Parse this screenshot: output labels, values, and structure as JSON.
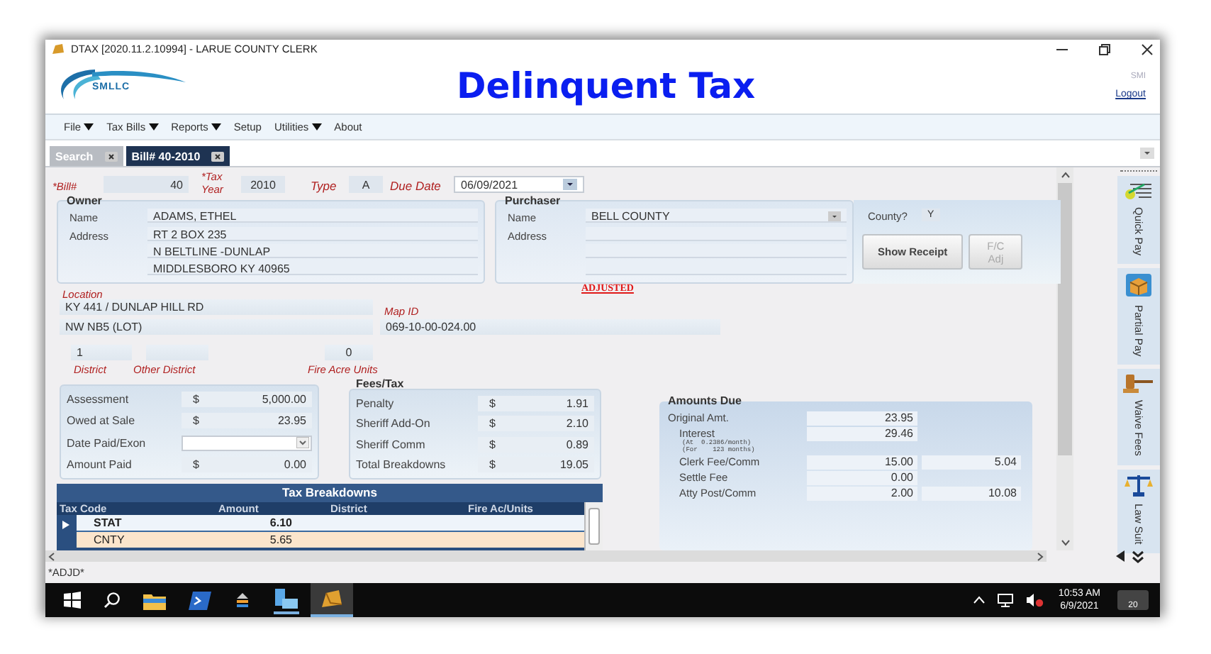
{
  "window": {
    "title": "DTAX [2020.11.2.10994] - LARUE COUNTY CLERK"
  },
  "header": {
    "logo_text": "SMLLC",
    "title": "Delinquent Tax",
    "user": "SMI",
    "logout": "Logout"
  },
  "menu": [
    {
      "label": "File",
      "has_submenu": true
    },
    {
      "label": "Tax Bills",
      "has_submenu": true
    },
    {
      "label": "Reports",
      "has_submenu": true
    },
    {
      "label": "Setup",
      "has_submenu": false
    },
    {
      "label": "Utilities",
      "has_submenu": true
    },
    {
      "label": "About",
      "has_submenu": false
    }
  ],
  "tabs": [
    {
      "label": "Search",
      "selected": false
    },
    {
      "label": "Bill# 40-2010",
      "selected": true
    }
  ],
  "bill": {
    "bill_label": "*Bill#",
    "bill_no": "40",
    "tax_year_label": "*Tax Year",
    "tax_year": "2010",
    "type_label": "Type",
    "type": "A",
    "due_date_label": "Due Date",
    "due_date": "06/09/2021"
  },
  "owner": {
    "legend": "Owner",
    "name_label": "Name",
    "address_label": "Address",
    "name": "ADAMS, ETHEL",
    "address_lines": [
      "RT 2 BOX 235",
      "N BELTLINE -DUNLAP",
      "MIDDLESBORO KY 40965"
    ]
  },
  "purchaser": {
    "legend": "Purchaser",
    "name_label": "Name",
    "address_label": "Address",
    "name": "BELL COUNTY"
  },
  "county": {
    "label": "County?",
    "value": "Y"
  },
  "buttons": [
    {
      "label": "Show Receipt",
      "disabled": false
    },
    {
      "label": "F/C Adj",
      "disabled": true
    }
  ],
  "status_stamp": "ADJUSTED",
  "location": {
    "label": "Location",
    "line_1": "KY 441 / DUNLAP HILL RD",
    "line_2": "NW NB5 (LOT)",
    "map_id_label": "Map ID",
    "map_id": "069-10-00-024.00"
  },
  "district": {
    "district": "1",
    "district_label": "District",
    "other_district_label": "Other District",
    "fire_acre_units": "0",
    "fire_acre_units_label": "Fire Acre Units"
  },
  "assessment": [
    {
      "kind": "money",
      "label": "Assessment",
      "currency": "$",
      "value": "5,000.00"
    },
    {
      "kind": "money",
      "label": "Owed at Sale",
      "currency": "$",
      "value": "23.95"
    },
    {
      "kind": "date",
      "label": "Date Paid/Exon"
    },
    {
      "kind": "money",
      "label": "Amount Paid",
      "currency": "$",
      "value": "0.00"
    }
  ],
  "fees": {
    "legend": "Fees/Tax",
    "rows": [
      {
        "label": "Penalty",
        "currency": "$",
        "value": "1.91"
      },
      {
        "label": "Sheriff Add-On",
        "currency": "$",
        "value": "2.10"
      },
      {
        "label": "Sheriff Comm",
        "currency": "$",
        "value": "0.89"
      },
      {
        "label": "Total Breakdowns",
        "currency": "$",
        "value": "19.05"
      }
    ]
  },
  "tax_breakdowns": {
    "title": "Tax Breakdowns",
    "columns": [
      "Tax Code",
      "Amount",
      "District",
      "Fire Ac/Units"
    ],
    "rows": [
      {
        "tax_code": "STAT",
        "amount": "6.10",
        "selected": true
      },
      {
        "tax_code": "CNTY",
        "amount": "5.65",
        "selected": false
      }
    ]
  },
  "amounts_due": {
    "legend": "Amounts Due",
    "rows": [
      {
        "label": "Original Amt.",
        "value": "23.95"
      },
      {
        "label": "Interest",
        "value": "29.46",
        "notes": [
          "(At  0.2386/month)",
          "(For    123 months)"
        ]
      },
      {
        "label": "Clerk Fee/Comm",
        "value": "15.00",
        "value_2": "5.04"
      },
      {
        "label": "Settle Fee",
        "value": "0.00"
      },
      {
        "label": "Atty Post/Comm",
        "value": "2.00",
        "value_2": "10.08"
      }
    ]
  },
  "side_panel": [
    {
      "kind": "notes",
      "label": "Quick Pay"
    },
    {
      "kind": "package",
      "label": "Partial Pay"
    },
    {
      "kind": "gavel",
      "label": "Waive Fees"
    },
    {
      "kind": "scales",
      "label": "Law Suit"
    }
  ],
  "status_bar": {
    "text": "*ADJD*"
  },
  "taskbar": {
    "time": "10:53 AM",
    "date": "6/9/2021",
    "notifications": "20"
  }
}
